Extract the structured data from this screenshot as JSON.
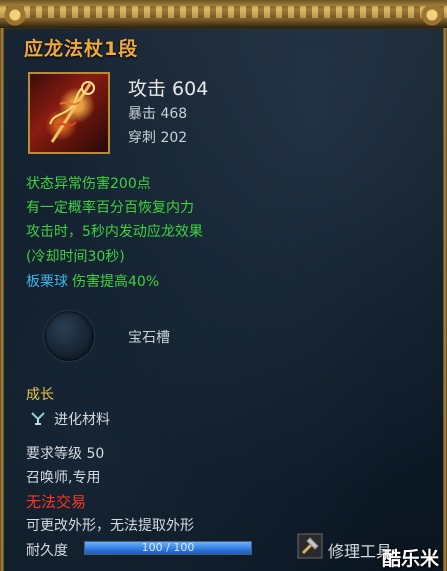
{
  "item": {
    "name": "应龙法杖1段",
    "attack_label": "攻击 604",
    "crit_label": "暴击 468",
    "pierce_label": "穿刺 202"
  },
  "effects": [
    "状态异常伤害200点",
    "有一定概率百分百恢复内力",
    "攻击时，5秒内发动应龙效果",
    "(冷却时间30秒)"
  ],
  "set_bonus": {
    "name": "板栗球",
    "text": "伤害提高40%"
  },
  "socket": {
    "label": "宝石槽"
  },
  "growth": {
    "title": "成长",
    "material_label": "进化材料"
  },
  "requirements": {
    "level": "要求等级 50",
    "class": "召唤师,专用"
  },
  "trade_status": "无法交易",
  "appearance_note": "可更改外形，无法提取外形",
  "durability": {
    "label": "耐久度",
    "text": "100 / 100",
    "current": 100,
    "max": 100
  },
  "repair": {
    "label": "修理工具"
  },
  "watermark": "酷乐米",
  "colors": {
    "title": "#f2a93a",
    "effect": "#3fd23f",
    "set": "#3fb6e8",
    "warning": "#ff3322",
    "growth": "#e8c24a",
    "bar": "#2f7ae0"
  },
  "icons": {
    "item": "staff-icon",
    "material": "evolution-material-icon",
    "repair": "hammer-icon",
    "socket": "gem-socket-icon"
  }
}
